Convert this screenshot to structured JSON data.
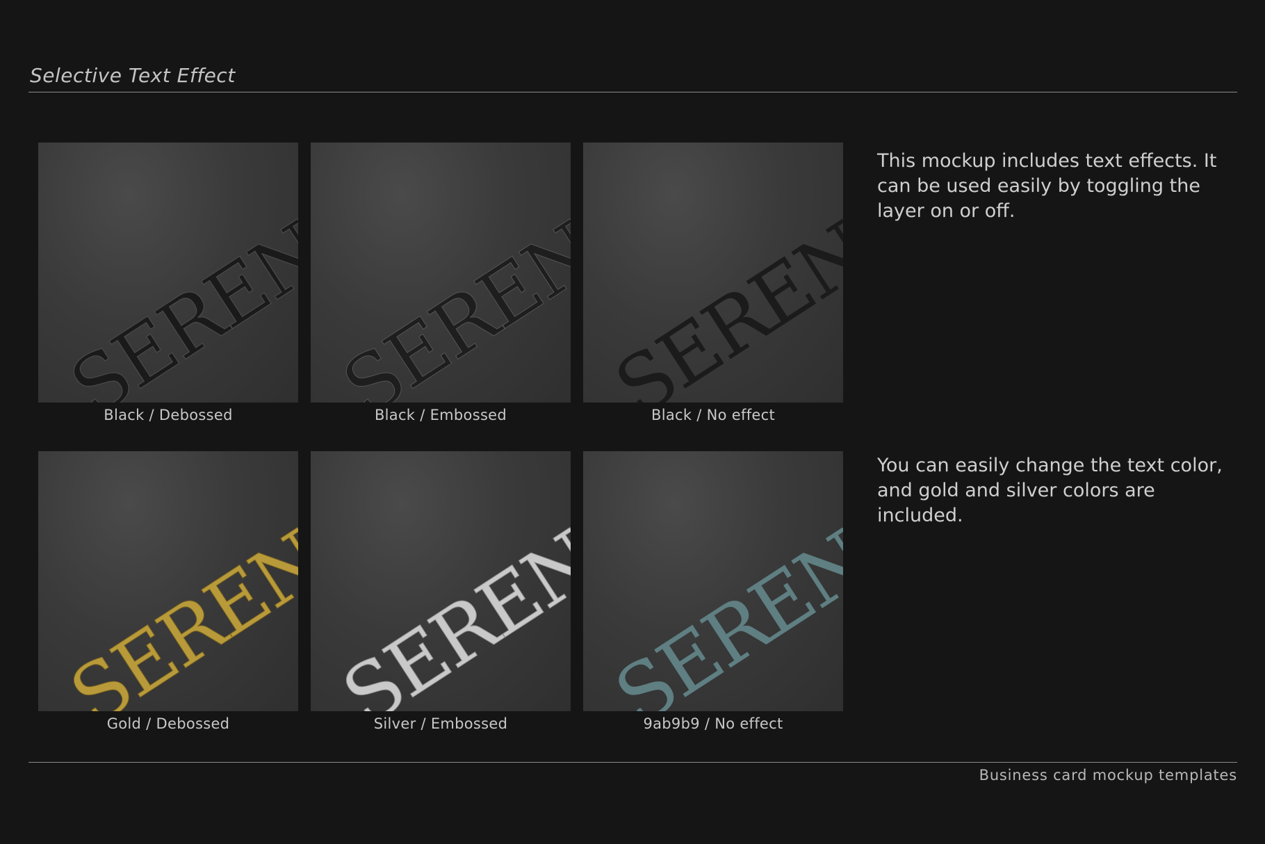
{
  "heading": "Selective Text Effect",
  "footer": "Business card mockup templates",
  "card_word": "SERENE",
  "tiles": [
    {
      "caption": "Black  /  Debossed",
      "color": "#1a1a1a",
      "effect": "debossed"
    },
    {
      "caption": "Black  /  Embossed",
      "color": "#1e1e1e",
      "effect": "embossed"
    },
    {
      "caption": "Black  /  No effect",
      "color": "#1b1b1b",
      "effect": "none"
    },
    {
      "caption": "Gold  /  Debossed",
      "color": "#b89a3a",
      "effect": "debossed"
    },
    {
      "caption": "Silver  /  Embossed",
      "color": "#c9c9c9",
      "effect": "embossed"
    },
    {
      "caption": "9ab9b9  /  No effect",
      "color": "#5f7f82",
      "effect": "none"
    }
  ],
  "descriptions": {
    "effects": "This mockup includes text effects. It can be used easily by toggling the layer on or off.",
    "colors": "You can easily change the text color, and gold and silver colors are included."
  }
}
